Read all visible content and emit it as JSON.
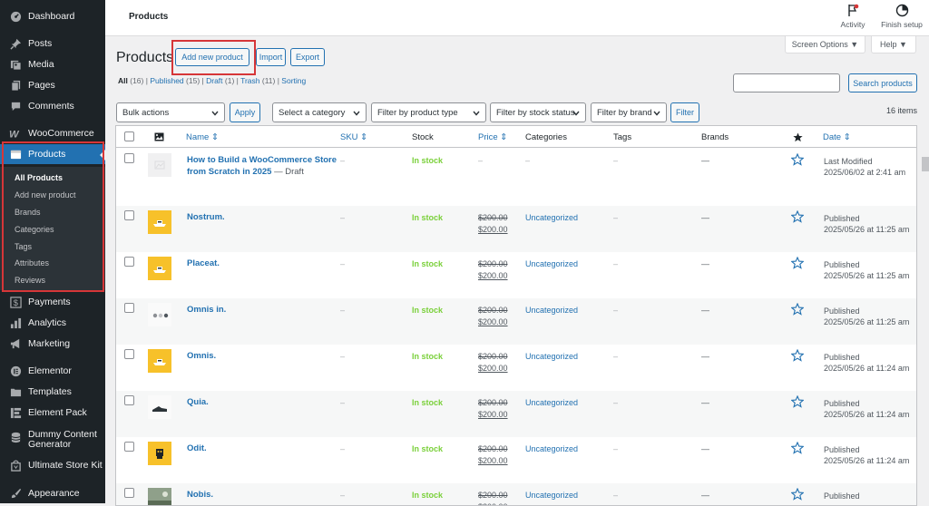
{
  "sidebar": {
    "items": [
      {
        "key": "dashboard",
        "label": "Dashboard",
        "icon": "dashboard-icon"
      },
      {
        "key": "posts",
        "label": "Posts",
        "icon": "pin-icon"
      },
      {
        "key": "media",
        "label": "Media",
        "icon": "media-icon"
      },
      {
        "key": "pages",
        "label": "Pages",
        "icon": "pages-icon"
      },
      {
        "key": "comments",
        "label": "Comments",
        "icon": "comment-icon"
      },
      {
        "key": "woocommerce",
        "label": "WooCommerce",
        "icon": "woo-icon"
      },
      {
        "key": "products",
        "label": "Products",
        "icon": "products-icon"
      },
      {
        "key": "payments",
        "label": "Payments",
        "icon": "dollar-icon"
      },
      {
        "key": "analytics",
        "label": "Analytics",
        "icon": "bar-chart-icon"
      },
      {
        "key": "marketing",
        "label": "Marketing",
        "icon": "megaphone-icon"
      },
      {
        "key": "elementor",
        "label": "Elementor",
        "icon": "elementor-icon"
      },
      {
        "key": "templates",
        "label": "Templates",
        "icon": "folder-icon"
      },
      {
        "key": "element_pack",
        "label": "Element Pack",
        "icon": "element-pack-icon"
      },
      {
        "key": "dummy",
        "label": "Dummy Content Generator",
        "icon": "database-icon"
      },
      {
        "key": "ultimate",
        "label": "Ultimate Store Kit",
        "icon": "bag-icon"
      },
      {
        "key": "appearance",
        "label": "Appearance",
        "icon": "brush-icon"
      }
    ],
    "submenu": [
      "All Products",
      "Add new product",
      "Brands",
      "Categories",
      "Tags",
      "Attributes",
      "Reviews"
    ]
  },
  "topbar": {
    "title": "Products",
    "activity": "Activity",
    "finish_setup": "Finish setup"
  },
  "screen_options": "Screen Options ▼",
  "help": "Help ▼",
  "header": {
    "title": "Products",
    "add_new": "Add new product",
    "import": "Import",
    "export": "Export"
  },
  "statuses": {
    "all": "All",
    "all_count": "(16)",
    "published": "Published",
    "published_count": "(15)",
    "draft": "Draft",
    "draft_count": "(1)",
    "trash": "Trash",
    "trash_count": "(11)",
    "sorting": "Sorting"
  },
  "search": {
    "button": "Search products",
    "placeholder": ""
  },
  "filters": {
    "bulk": "Bulk actions",
    "apply": "Apply",
    "category": "Select a category",
    "product_type": "Filter by product type",
    "stock_status": "Filter by stock status",
    "brand": "Filter by brand",
    "filter": "Filter",
    "items": "16 items"
  },
  "columns": {
    "name": "Name ⇕",
    "sku": "SKU ⇕",
    "stock": "Stock",
    "price": "Price ⇕",
    "categories": "Categories",
    "tags": "Tags",
    "brands": "Brands",
    "date": "Date ⇕"
  },
  "rows": [
    {
      "name": "How to Build a WooCommerce Store from Scratch in 2025",
      "draft": " — Draft",
      "sku": "–",
      "stock": "In stock",
      "old_price": "–",
      "price": "",
      "category": "–",
      "tags": "–",
      "brands": "—",
      "status": "Last Modified",
      "date": "2025/06/02 at 2:41 am",
      "thumb": "placeholder"
    },
    {
      "name": "Nostrum.",
      "draft": "",
      "sku": "–",
      "stock": "In stock",
      "old_price": "$200.00",
      "price": "$200.00",
      "category": "Uncategorized",
      "tags": "–",
      "brands": "—",
      "status": "Published",
      "date": "2025/05/26 at 11:25 am",
      "thumb": "boat"
    },
    {
      "name": "Placeat.",
      "draft": "",
      "sku": "–",
      "stock": "In stock",
      "old_price": "$200.00",
      "price": "$200.00",
      "category": "Uncategorized",
      "tags": "–",
      "brands": "—",
      "status": "Published",
      "date": "2025/05/26 at 11:25 am",
      "thumb": "boat"
    },
    {
      "name": "Omnis in.",
      "draft": "",
      "sku": "–",
      "stock": "In stock",
      "old_price": "$200.00",
      "price": "$200.00",
      "category": "Uncategorized",
      "tags": "–",
      "brands": "—",
      "status": "Published",
      "date": "2025/05/26 at 11:25 am",
      "thumb": "dots"
    },
    {
      "name": "Omnis.",
      "draft": "",
      "sku": "–",
      "stock": "In stock",
      "old_price": "$200.00",
      "price": "$200.00",
      "category": "Uncategorized",
      "tags": "–",
      "brands": "—",
      "status": "Published",
      "date": "2025/05/26 at 11:24 am",
      "thumb": "boat"
    },
    {
      "name": "Quia.",
      "draft": "",
      "sku": "–",
      "stock": "In stock",
      "old_price": "$200.00",
      "price": "$200.00",
      "category": "Uncategorized",
      "tags": "–",
      "brands": "—",
      "status": "Published",
      "date": "2025/05/26 at 11:24 am",
      "thumb": "shoe"
    },
    {
      "name": "Odit.",
      "draft": "",
      "sku": "–",
      "stock": "In stock",
      "old_price": "$200.00",
      "price": "$200.00",
      "category": "Uncategorized",
      "tags": "–",
      "brands": "—",
      "status": "Published",
      "date": "2025/05/26 at 11:24 am",
      "thumb": "figure"
    },
    {
      "name": "Nobis.",
      "draft": "",
      "sku": "–",
      "stock": "In stock",
      "old_price": "$200.00",
      "price": "$200.00",
      "category": "Uncategorized",
      "tags": "–",
      "brands": "—",
      "status": "Published",
      "date": "",
      "thumb": "photo"
    }
  ],
  "colors": {
    "accent": "#2271b1",
    "sidebar": "#1d2327",
    "instock": "#7ad03a",
    "highlight": "#d63638"
  }
}
